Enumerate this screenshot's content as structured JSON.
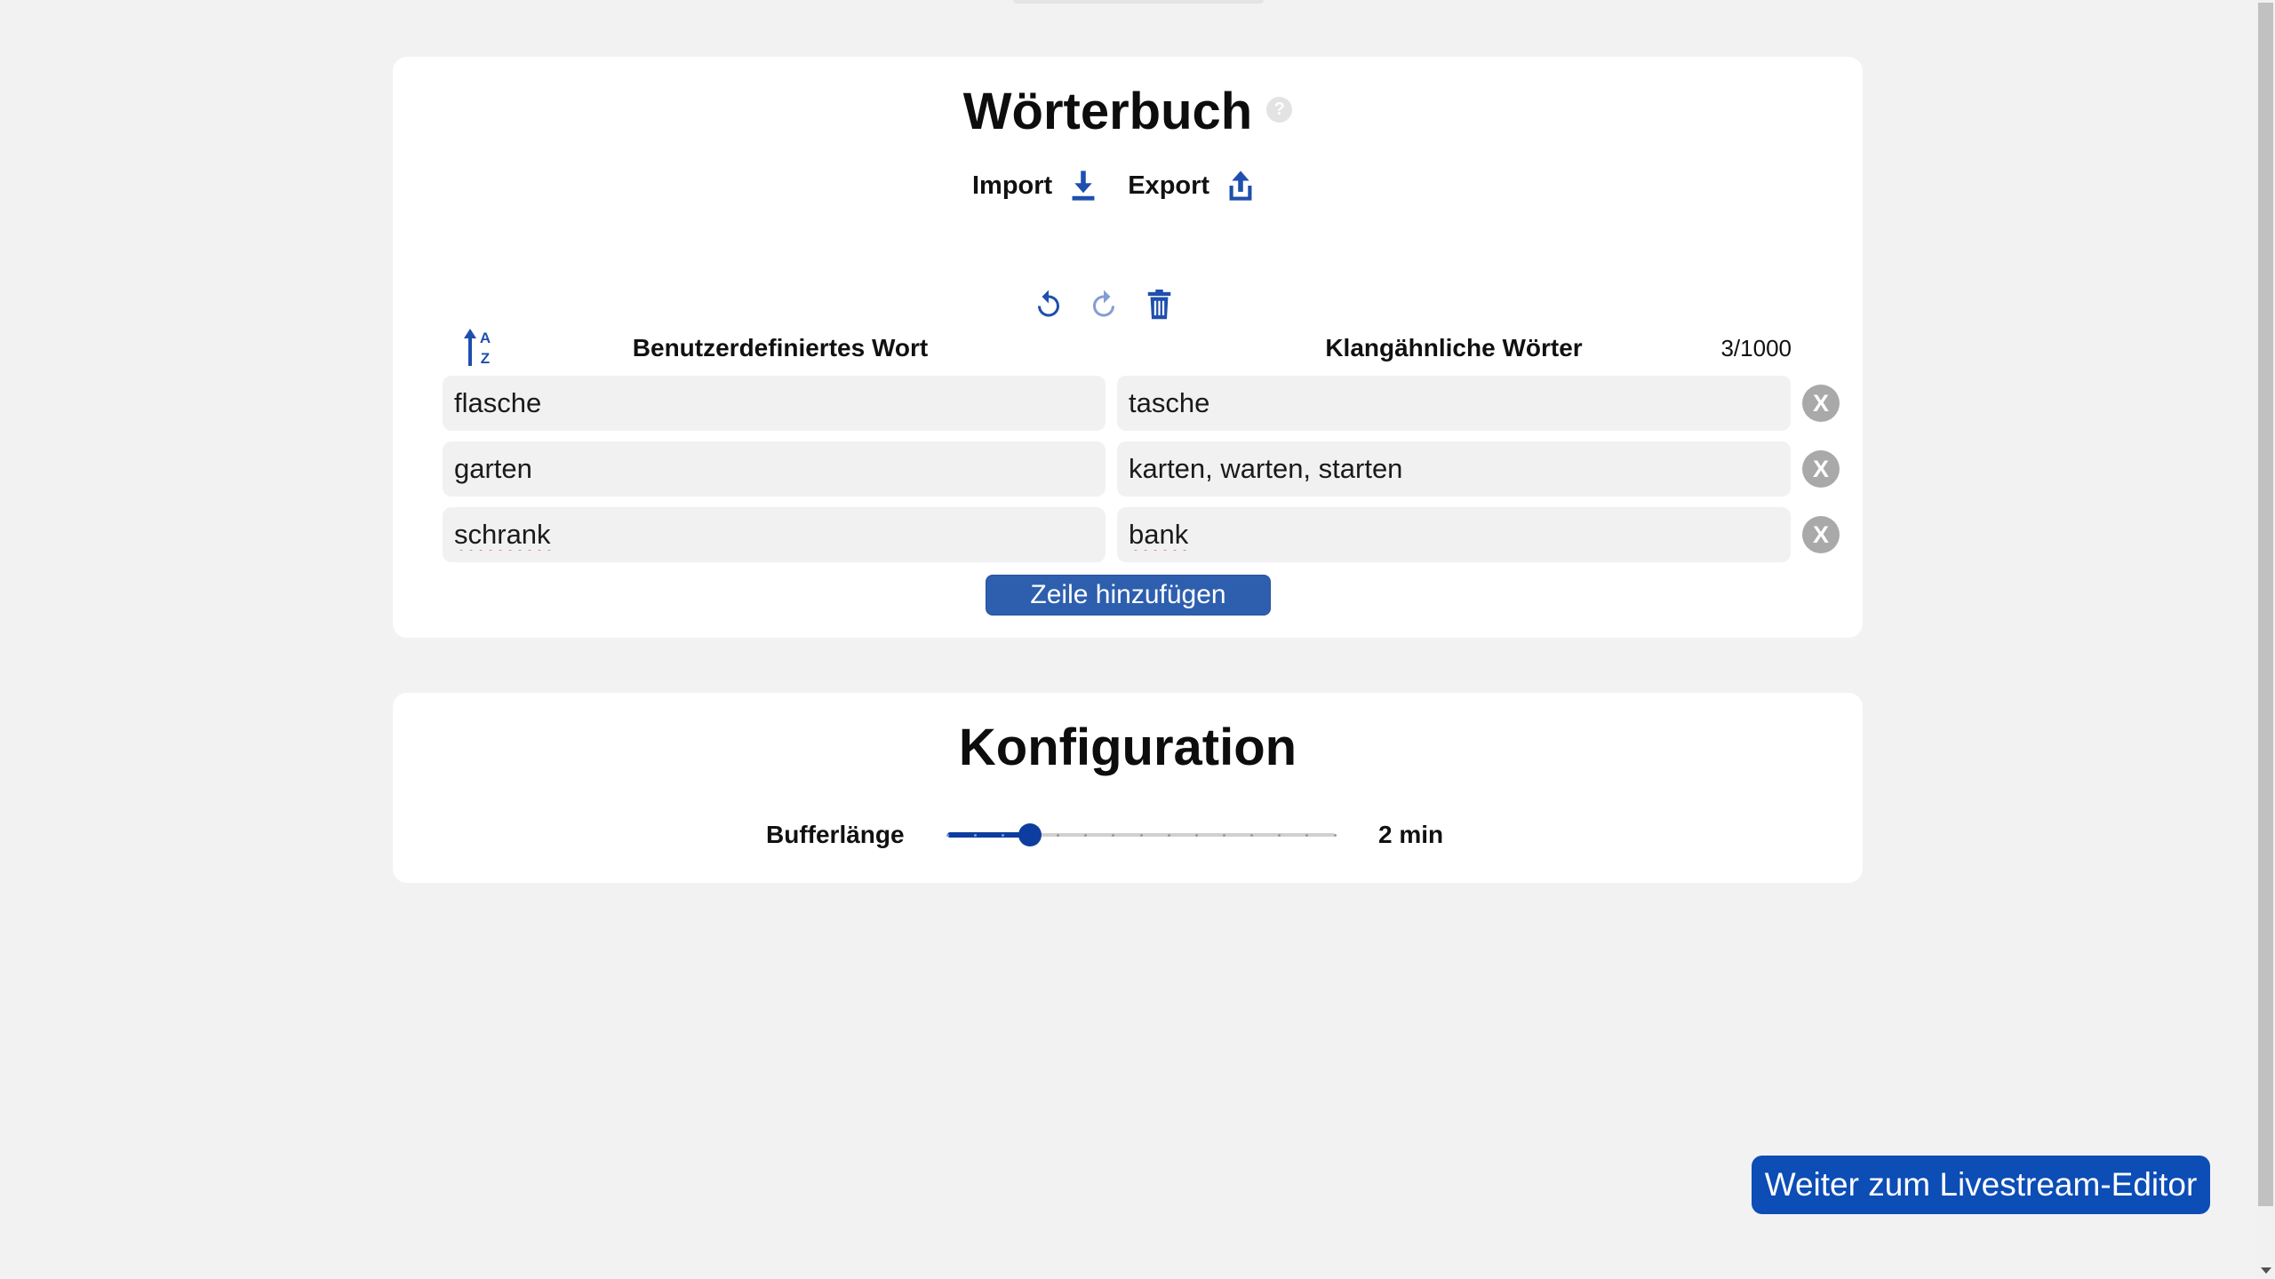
{
  "dictionary": {
    "title": "Wörterbuch",
    "help_icon": "question-circle-icon",
    "help_glyph": "?",
    "import_label": "Import",
    "import_icon": "download-icon",
    "export_label": "Export",
    "export_icon": "upload-icon",
    "toolbar": {
      "undo_icon": "undo-icon",
      "redo_icon": "redo-icon",
      "redo_enabled": false,
      "delete_icon": "trash-icon"
    },
    "sort_icon": "sort-alpha-icon",
    "sort_letters": {
      "top": "A",
      "bottom": "Z"
    },
    "columns": {
      "word": "Benutzerdefiniertes Wort",
      "similar": "Klangähnliche Wörter"
    },
    "count": "3/1000",
    "rows": [
      {
        "word": "flasche",
        "similar": "tasche",
        "word_flagged": false,
        "similar_flagged": false
      },
      {
        "word": "garten",
        "similar": "karten, warten, starten",
        "word_flagged": false,
        "similar_flagged": false
      },
      {
        "word": "schrank",
        "similar": "bank",
        "word_flagged": true,
        "similar_flagged": true
      }
    ],
    "remove_glyph": "X",
    "add_row_label": "Zeile hinzufügen"
  },
  "configuration": {
    "title": "Konfiguration",
    "buffer_label": "Bufferlänge",
    "buffer_value": "2 min",
    "buffer_level": 0.214
  },
  "next_button": "Weiter zum Livestream-Editor",
  "colors": {
    "accent": "#1f4fad",
    "add_row_button": "#2e5fae",
    "next_button": "#0c4db6",
    "remove_button": "#a9a9a9",
    "slider": "#0d3e9f",
    "page_background": "#f2f2f2",
    "field_background": "#f1f1f1",
    "spellcheck_underline": "#d93025"
  }
}
